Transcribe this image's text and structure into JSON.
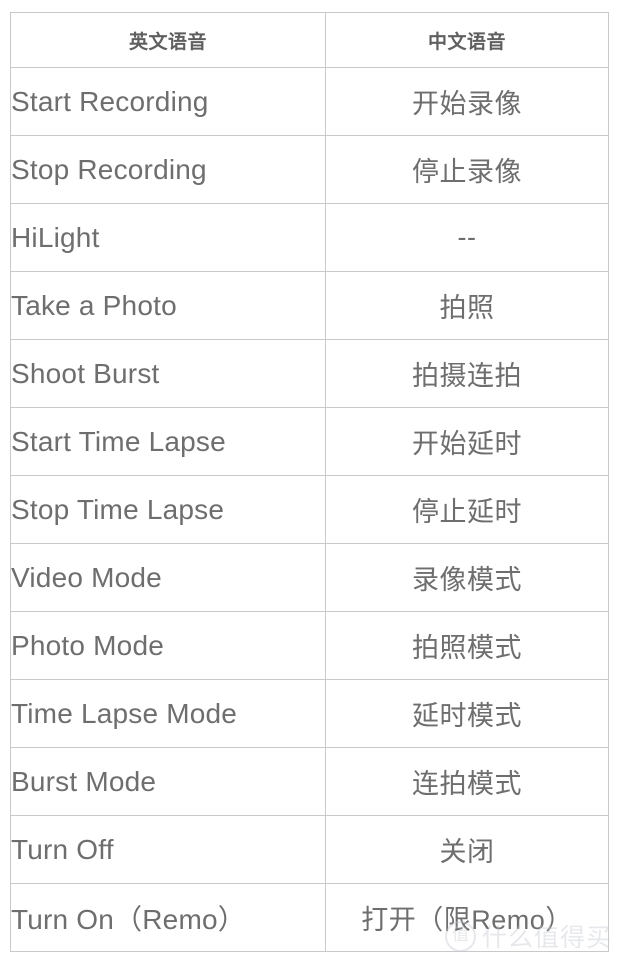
{
  "table": {
    "columns": [
      {
        "key": "en",
        "header": "英文语音",
        "align": "left"
      },
      {
        "key": "zh",
        "header": "中文语音",
        "align": "center"
      }
    ],
    "rows": [
      {
        "en": "Start Recording",
        "zh": "开始录像"
      },
      {
        "en": "Stop Recording",
        "zh": "停止录像"
      },
      {
        "en": "HiLight",
        "zh": "--"
      },
      {
        "en": "Take a Photo",
        "zh": "拍照"
      },
      {
        "en": "Shoot Burst",
        "zh": "拍摄连拍"
      },
      {
        "en": "Start Time Lapse",
        "zh": "开始延时"
      },
      {
        "en": "Stop Time Lapse",
        "zh": "停止延时"
      },
      {
        "en": "Video Mode",
        "zh": "录像模式"
      },
      {
        "en": "Photo Mode",
        "zh": "拍照模式"
      },
      {
        "en": "Time Lapse Mode",
        "zh": "延时模式"
      },
      {
        "en": "Burst Mode",
        "zh": "连拍模式"
      },
      {
        "en": "Turn Off",
        "zh": "关闭"
      },
      {
        "en": "Turn On（Remo）",
        "zh": "打开（限Remo）"
      }
    ]
  },
  "watermark": {
    "badge": "值",
    "text": "什么值得买"
  },
  "colors": {
    "text": "#6e6e6e",
    "header_text": "#5f5f5f",
    "border": "#c9c9c9",
    "background": "#ffffff",
    "watermark": "#c3c8cf"
  }
}
